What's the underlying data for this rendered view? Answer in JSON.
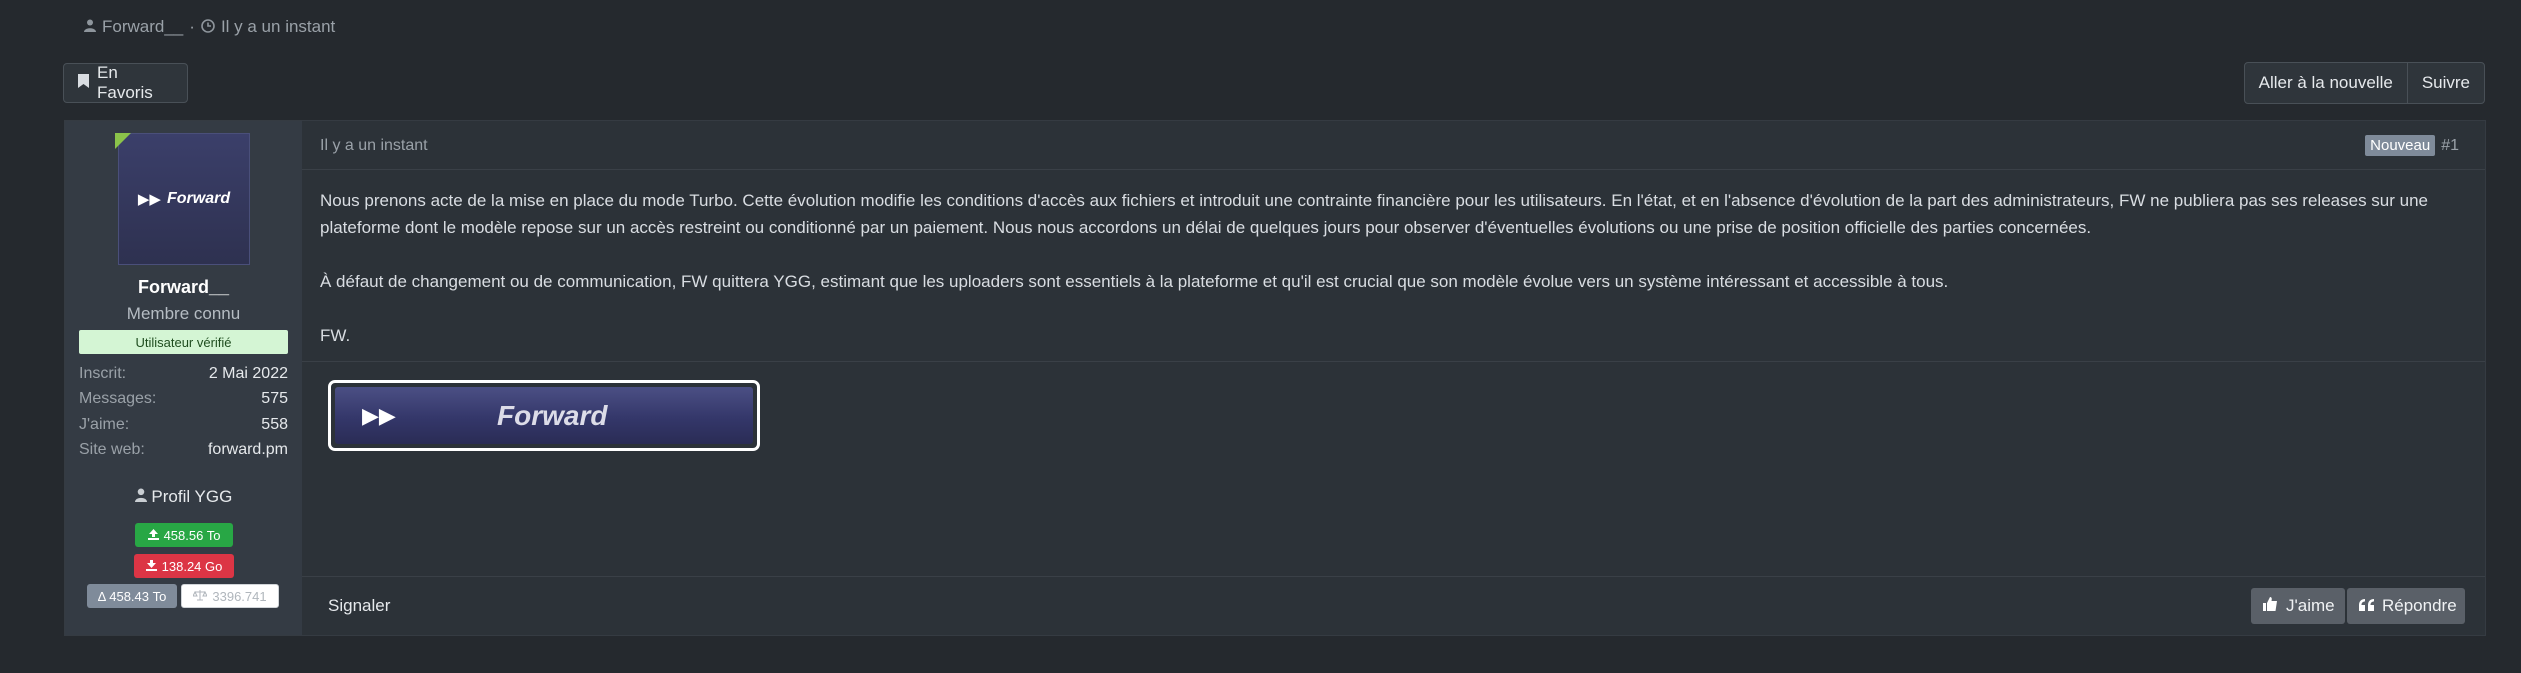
{
  "thread": {
    "author": "Forward__",
    "separator": "·",
    "time": "Il y a un instant"
  },
  "toolbar": {
    "favorite_label": "En Favoris",
    "goto_new_label": "Aller à la nouvelle",
    "follow_label": "Suivre"
  },
  "user": {
    "avatar_text": "Forward",
    "name": "Forward__",
    "title": "Membre connu",
    "verified": "Utilisateur vérifié",
    "stats": [
      {
        "label": "Inscrit:",
        "value": "2 Mai 2022"
      },
      {
        "label": "Messages:",
        "value": "575"
      },
      {
        "label": "J'aime:",
        "value": "558"
      },
      {
        "label": "Site web:",
        "value": "forward.pm"
      }
    ],
    "profile_label": "Profil YGG",
    "upload": "458.56 To",
    "download": "138.24 Go",
    "delta": "Δ 458.43 To",
    "ratio": "3396.741"
  },
  "post": {
    "time": "Il y a un instant",
    "new_tag": "Nouveau",
    "number": "#1",
    "paragraphs": [
      "Nous prenons acte de la mise en place du mode Turbo. Cette évolution modifie les conditions d'accès aux fichiers et introduit une contrainte financière pour les utilisateurs. En l'état, et en l'absence d'évolution de la part des administrateurs, FW ne publiera pas ses releases sur une plateforme dont le modèle repose sur un accès restreint ou conditionné par un paiement. Nous nous accordons un délai de quelques jours pour observer d'éventuelles évolutions ou une prise de position officielle des parties concernées.",
      "À défaut de changement ou de communication, FW quittera YGG, estimant que les uploaders sont essentiels à la plateforme et qu'il est crucial que son modèle évolue vers un système intéressant et accessible à tous.",
      "FW."
    ],
    "banner_text": "Forward",
    "report_label": "Signaler",
    "like_label": "J'aime",
    "reply_label": "Répondre"
  },
  "icons": {
    "user": "user-icon",
    "clock": "clock-icon",
    "bookmark": "bookmark-icon",
    "upload": "upload-icon",
    "download": "download-icon",
    "scale": "scale-icon",
    "thumbs_up": "thumbs-up-icon",
    "quote": "quote-icon"
  }
}
